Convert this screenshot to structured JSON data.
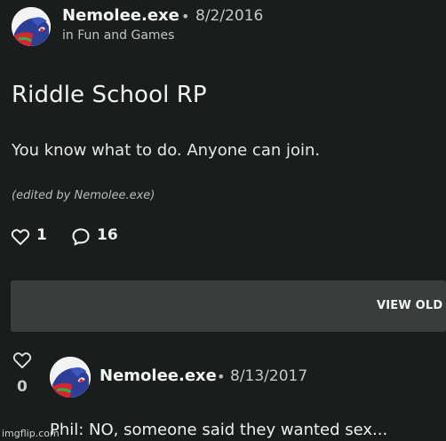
{
  "post": {
    "author": "Nemolee.exe",
    "separator": "•",
    "date": "8/2/2016",
    "community": "in Fun and Games",
    "title": "Riddle School RP",
    "body": "You know what to do. Anyone can join.",
    "edited": "(edited by Nemolee.exe)",
    "likes": "1",
    "comments": "16",
    "icons": {
      "like": "heart-icon",
      "comment": "speech-bubble-icon",
      "avatar": "avatar-image"
    }
  },
  "load_more": {
    "label": "VIEW OLD"
  },
  "comment": {
    "author": "Nemolee.exe",
    "separator": "•",
    "date": "8/13/2017",
    "votes": "0",
    "text": "Phil: NO, someone said they wanted sex..."
  },
  "watermark": {
    "text": "imgflip.com"
  },
  "colors": {
    "background": "#191d1d",
    "load_bar": "#3a3d3d",
    "text": "#e9ecec"
  }
}
